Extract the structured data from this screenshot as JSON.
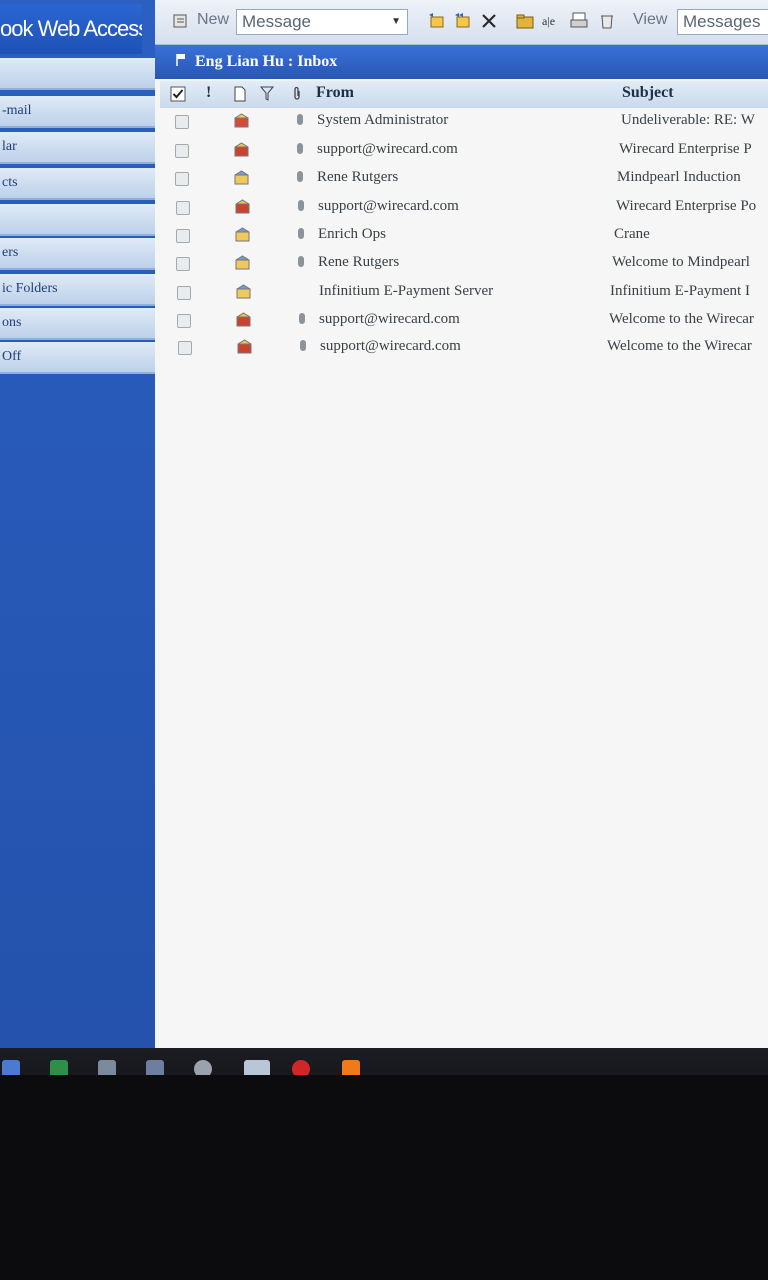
{
  "app": {
    "brand": "ook Web Access"
  },
  "sidebar": {
    "items": [
      {
        "label": ""
      },
      {
        "label": "-mail"
      },
      {
        "label": "lar"
      },
      {
        "label": "cts"
      },
      {
        "label": ""
      },
      {
        "label": "ers"
      },
      {
        "label": "ic Folders"
      },
      {
        "label": "ons"
      },
      {
        "label": " Off"
      }
    ]
  },
  "toolbar": {
    "new_label": "New",
    "new_selected": "Message",
    "view_label": "View",
    "view_selected": "Messages"
  },
  "folder": {
    "title": "Eng Lian Hu : Inbox"
  },
  "columns": {
    "importance": "!",
    "from": "From",
    "subject": "Subject"
  },
  "messages": [
    {
      "from": "System Administrator",
      "subject": "Undeliverable: RE: W",
      "icon": "undeliverable-icon",
      "attachment": true
    },
    {
      "from": "support@wirecard.com",
      "subject": "Wirecard Enterprise P",
      "icon": "meeting-request-icon",
      "attachment": true
    },
    {
      "from": "Rene Rutgers",
      "subject": "Mindpearl Induction",
      "icon": "read-message-icon",
      "attachment": true
    },
    {
      "from": "support@wirecard.com",
      "subject": "Wirecard Enterprise Po",
      "icon": "meeting-request-icon",
      "attachment": true
    },
    {
      "from": "Enrich Ops",
      "subject": "Crane",
      "icon": "read-message-icon",
      "attachment": true
    },
    {
      "from": "Rene Rutgers",
      "subject": "Welcome to Mindpearl",
      "icon": "read-message-icon",
      "attachment": true
    },
    {
      "from": "Infinitium E-Payment Server",
      "subject": "Infinitium E-Payment I",
      "icon": "read-message-icon",
      "attachment": false
    },
    {
      "from": "support@wirecard.com",
      "subject": "Welcome to the Wirecar",
      "icon": "meeting-request-icon",
      "attachment": true
    },
    {
      "from": "support@wirecard.com",
      "subject": "Welcome to the Wirecar",
      "icon": "meeting-request-icon",
      "attachment": true
    }
  ],
  "colors": {
    "accent": "#2a62c9",
    "header_bar": "#3a72d8"
  }
}
